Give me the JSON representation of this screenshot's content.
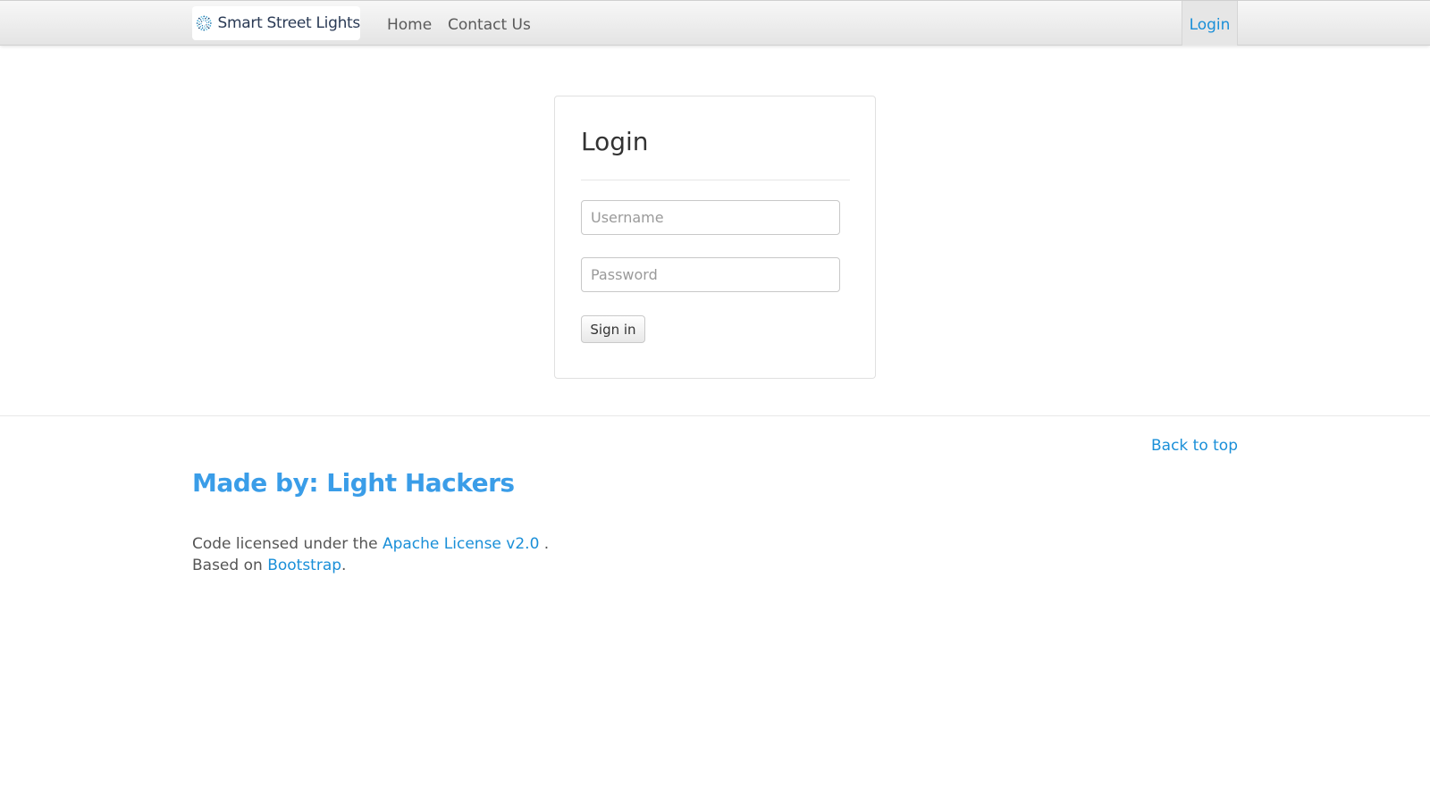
{
  "navbar": {
    "brand_text": "Smart Street Lights",
    "brand_icon": "smart-lights-logo-icon",
    "links": {
      "home": "Home",
      "contact": "Contact Us",
      "login": "Login"
    }
  },
  "login_card": {
    "title": "Login",
    "username_placeholder": "Username",
    "password_placeholder": "Password",
    "submit_label": "Sign in"
  },
  "footer": {
    "back_to_top": "Back to top",
    "made_by": "Made by: Light Hackers",
    "license_prefix": "Code licensed under the",
    "license_link": "Apache License v2.0",
    "license_suffix": ".",
    "based_prefix": "Based on",
    "based_link": "Bootstrap",
    "based_suffix": "."
  },
  "colors": {
    "link": "#1a8fd8",
    "heading_accent": "#3a9de8",
    "text": "#555555"
  }
}
